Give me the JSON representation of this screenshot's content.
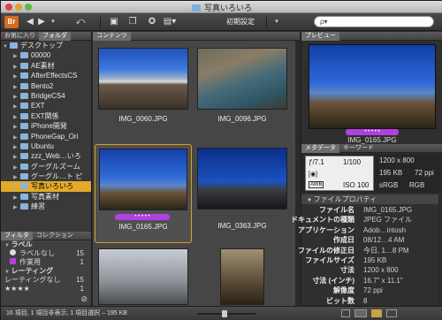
{
  "window": {
    "title": "写真いろいろ"
  },
  "toolbar": {
    "app_label": "Br",
    "workspace": "初期設定",
    "search_placeholder": "ρ▾"
  },
  "left": {
    "tabs": [
      "お気に入り",
      "フォルダ"
    ],
    "tree": [
      {
        "label": "デスクトップ",
        "indent": 0,
        "open": true
      },
      {
        "label": "00000",
        "indent": 1
      },
      {
        "label": "AE素材",
        "indent": 1
      },
      {
        "label": "AfterEffectsCS",
        "indent": 1
      },
      {
        "label": "Bento2",
        "indent": 1
      },
      {
        "label": "BridgeCS4",
        "indent": 1
      },
      {
        "label": "EXT",
        "indent": 1
      },
      {
        "label": "EXT関係",
        "indent": 1
      },
      {
        "label": "iPhone開発",
        "indent": 1
      },
      {
        "label": "PhoneGap_Ori",
        "indent": 1
      },
      {
        "label": "Ubuntu",
        "indent": 1
      },
      {
        "label": "zzz_Web…いろ",
        "indent": 1
      },
      {
        "label": "グーグルズーム",
        "indent": 1
      },
      {
        "label": "グーグル…ト ピ",
        "indent": 1
      },
      {
        "label": "写真いろいろ",
        "indent": 1,
        "selected": true
      },
      {
        "label": "写真素材",
        "indent": 1
      },
      {
        "label": "練習",
        "indent": 1
      }
    ],
    "filter_tabs": [
      "フィルタ",
      "コレクション"
    ],
    "labels_header": "ラベル",
    "labels": [
      {
        "name": "ラベルなし",
        "count": "15"
      },
      {
        "name": "作業用",
        "count": "1"
      }
    ],
    "rating_header": "レーティング",
    "ratings": [
      {
        "name": "レーティングなし",
        "count": "15"
      },
      {
        "name": "★★★★",
        "count": "1"
      }
    ]
  },
  "content": {
    "tab": "コンテンツ",
    "thumbs": [
      {
        "name": "IMG_0060.JPG"
      },
      {
        "name": "IMG_0096.JPG"
      },
      {
        "name": "IMG_0165.JPG",
        "selected": true,
        "rating": "• • • • •"
      },
      {
        "name": "IMG_0363.JPG"
      }
    ]
  },
  "right": {
    "preview_tab": "プレビュー",
    "preview_caption": "IMG_0165.JPG",
    "preview_rating": "• • • • •",
    "meta_tabs": [
      "メタデータ",
      "キーワード"
    ],
    "exif": {
      "fstop": "ƒ/7.1",
      "shutter": "1/100",
      "iso": "ISO 100",
      "awb": "AWB",
      "dims": "1200 x 800",
      "size": "195 KB",
      "ppi": "72 ppi",
      "cs": "sRGB",
      "mode": "RGB"
    },
    "file_props_header": "ファイルプロパティ",
    "props": [
      {
        "k": "ファイル名",
        "v": "IMG_0165.JPG"
      },
      {
        "k": "ドキュメントの種類",
        "v": "JPEG ファイル"
      },
      {
        "k": "アプリケーション",
        "v": "Adob…intosh"
      },
      {
        "k": "作成日",
        "v": "08/12…4 AM"
      },
      {
        "k": "ファイルの修正日",
        "v": "今日, 1…8 PM"
      },
      {
        "k": "ファイルサイズ",
        "v": "195 KB"
      },
      {
        "k": "寸法",
        "v": "1200 x 800"
      },
      {
        "k": "寸法 (インチ)",
        "v": "16.7\" x 11.1\""
      },
      {
        "k": "解像度",
        "v": "72 ppi"
      },
      {
        "k": "ビット数",
        "v": "8"
      }
    ]
  },
  "status": {
    "text": "16 項目, 1 項目非表示, 1 項目選択 – 195 KB"
  }
}
